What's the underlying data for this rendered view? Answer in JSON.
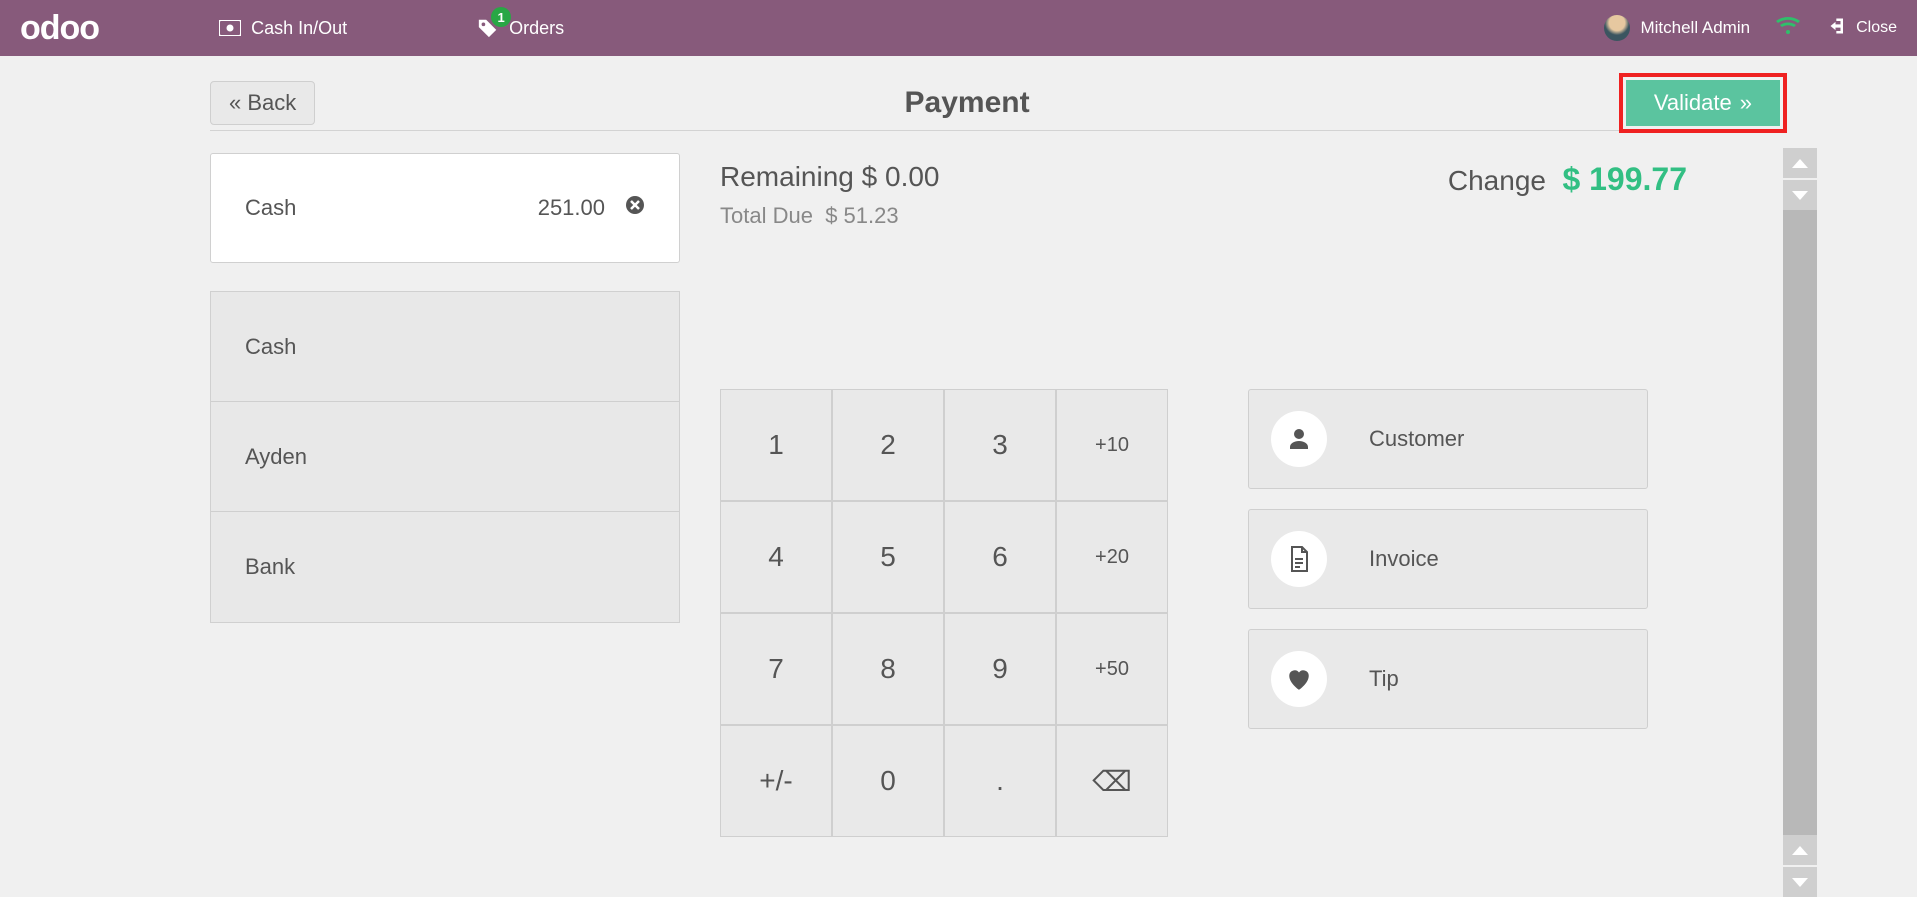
{
  "topbar": {
    "logo": "odoo",
    "cash_in_out": "Cash In/Out",
    "orders": "Orders",
    "orders_badge": "1",
    "user_name": "Mitchell Admin",
    "close": "Close"
  },
  "header": {
    "back": "Back",
    "title": "Payment",
    "validate": "Validate"
  },
  "payment_line": {
    "method": "Cash",
    "amount": "251.00"
  },
  "methods": [
    "Cash",
    "Ayden",
    "Bank"
  ],
  "summary": {
    "remaining_label": "Remaining",
    "remaining_value": "$ 0.00",
    "total_due_label": "Total Due",
    "total_due_value": "$ 51.23",
    "change_label": "Change",
    "change_value": "$ 199.77"
  },
  "keypad": {
    "k1": "1",
    "k2": "2",
    "k3": "3",
    "p10": "+10",
    "k4": "4",
    "k5": "5",
    "k6": "6",
    "p20": "+20",
    "k7": "7",
    "k8": "8",
    "k9": "9",
    "p50": "+50",
    "pm": "+/-",
    "k0": "0",
    "dot": ".",
    "bs": "⌫"
  },
  "side": {
    "customer": "Customer",
    "invoice": "Invoice",
    "tip": "Tip"
  }
}
